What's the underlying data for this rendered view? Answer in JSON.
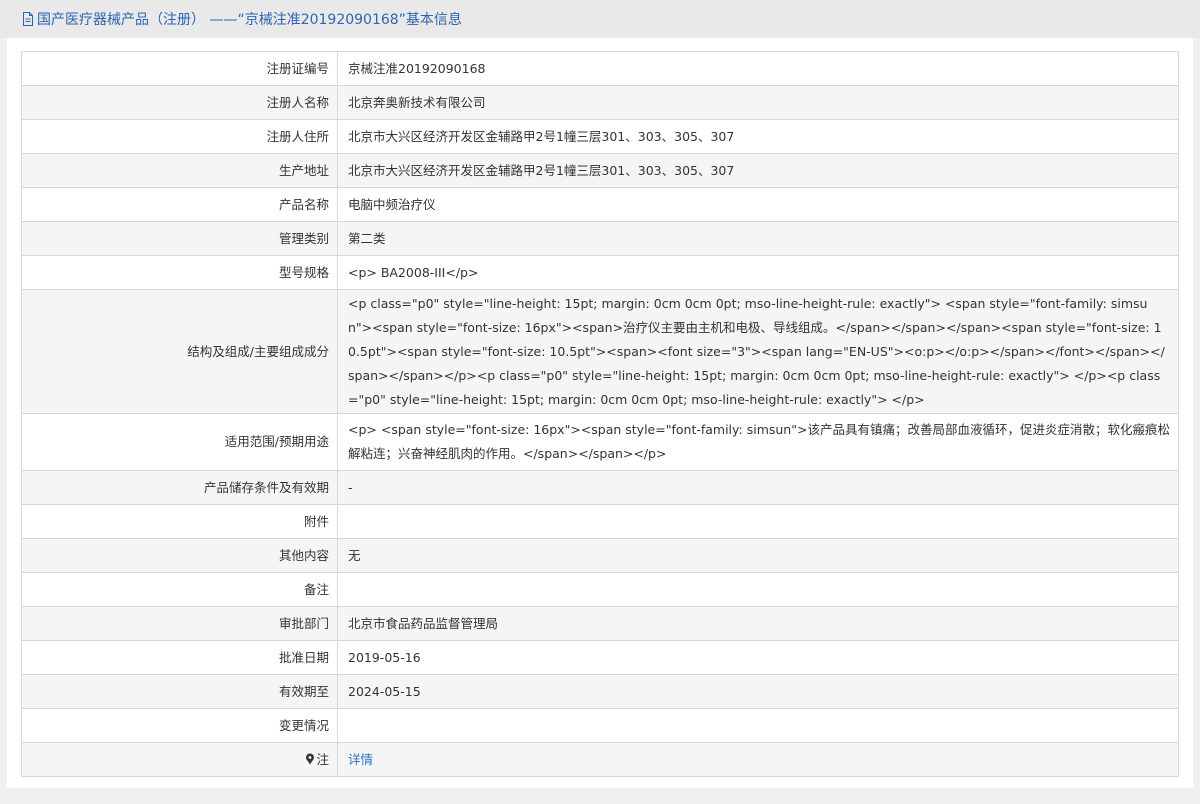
{
  "header": {
    "title": "国产医疗器械产品（注册） ——“京械注准20192090168”基本信息"
  },
  "rows": [
    {
      "label": "注册证编号",
      "value": "京械注准20192090168"
    },
    {
      "label": "注册人名称",
      "value": "北京奔奥新技术有限公司"
    },
    {
      "label": "注册人住所",
      "value": "北京市大兴区经济开发区金辅路甲2号1幢三层301、303、305、307"
    },
    {
      "label": "生产地址",
      "value": "北京市大兴区经济开发区金辅路甲2号1幢三层301、303、305、307"
    },
    {
      "label": "产品名称",
      "value": "电脑中频治疗仪"
    },
    {
      "label": "管理类别",
      "value": "第二类"
    },
    {
      "label": "型号规格",
      "value": "<p> BA2008-III</p>"
    },
    {
      "label": "结构及组成/主要组成成分",
      "value": "<p class=\"p0\" style=\"line-height: 15pt; margin: 0cm 0cm 0pt; mso-line-height-rule: exactly\"> <span style=\"font-family: simsun\"><span style=\"font-size: 16px\"><span>治疗仪主要由主机和电极、导线组成。</span></span></span><span style=\"font-size: 10.5pt\"><span style=\"font-size: 10.5pt\"><span><font size=\"3\"><span lang=\"EN-US\"><o:p></o:p></span></font></span></span></span></p><p class=\"p0\" style=\"line-height: 15pt; margin: 0cm 0cm 0pt; mso-line-height-rule: exactly\"> </p><p class=\"p0\" style=\"line-height: 15pt; margin: 0cm 0cm 0pt; mso-line-height-rule: exactly\"> </p>"
    },
    {
      "label": "适用范围/预期用途",
      "value": "<p> <span style=\"font-size: 16px\"><span style=\"font-family: simsun\">该产品具有镇痛；改善局部血液循环，促进炎症消散；软化瘢痕松解粘连；兴奋神经肌肉的作用。</span></span></p>"
    },
    {
      "label": "产品储存条件及有效期",
      "value": "-"
    },
    {
      "label": "附件",
      "value": ""
    },
    {
      "label": "其他内容",
      "value": "无"
    },
    {
      "label": "备注",
      "value": ""
    },
    {
      "label": "审批部门",
      "value": "北京市食品药品监督管理局"
    },
    {
      "label": "批准日期",
      "value": "2019-05-16"
    },
    {
      "label": "有效期至",
      "value": "2024-05-15"
    },
    {
      "label": "变更情况",
      "value": ""
    }
  ],
  "note_row": {
    "label": "注",
    "link_text": "详情"
  }
}
